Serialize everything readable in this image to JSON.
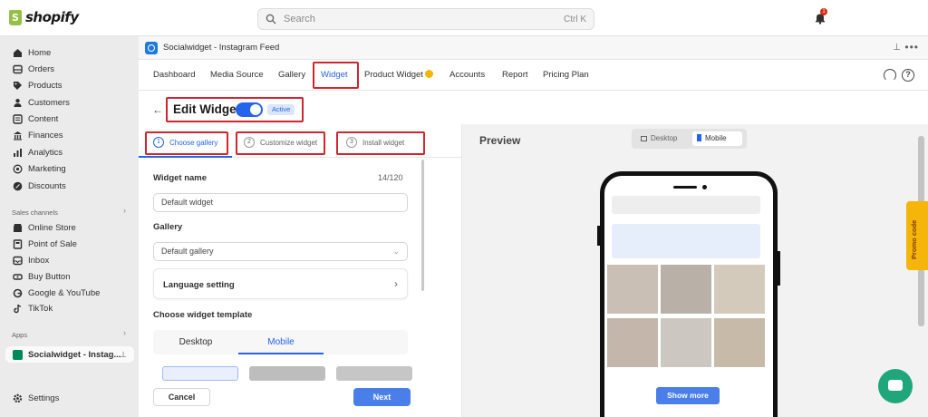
{
  "topbar": {
    "logo_text": "shopify",
    "search_placeholder": "Search",
    "search_shortcut": "Ctrl K",
    "notification_count": "1"
  },
  "sidebar": {
    "items": [
      {
        "label": "Home",
        "icon": "home-icon"
      },
      {
        "label": "Orders",
        "icon": "orders-icon"
      },
      {
        "label": "Products",
        "icon": "tag-icon"
      },
      {
        "label": "Customers",
        "icon": "person-icon"
      },
      {
        "label": "Content",
        "icon": "content-icon"
      },
      {
        "label": "Finances",
        "icon": "bank-icon"
      },
      {
        "label": "Analytics",
        "icon": "chart-icon"
      },
      {
        "label": "Marketing",
        "icon": "target-icon"
      },
      {
        "label": "Discounts",
        "icon": "discount-icon"
      }
    ],
    "sales_channels_label": "Sales channels",
    "channels": [
      {
        "label": "Online Store",
        "icon": "store-icon"
      },
      {
        "label": "Point of Sale",
        "icon": "pos-icon"
      },
      {
        "label": "Inbox",
        "icon": "inbox-icon"
      },
      {
        "label": "Buy Button",
        "icon": "buy-button-icon"
      },
      {
        "label": "Google & YouTube",
        "icon": "google-icon"
      },
      {
        "label": "TikTok",
        "icon": "tiktok-icon"
      }
    ],
    "apps_label": "Apps",
    "active_app": "Socialwidget - Instag...",
    "settings": "Settings"
  },
  "app": {
    "title": "Socialwidget - Instagram Feed",
    "tabs": [
      "Dashboard",
      "Media Source",
      "Gallery",
      "Widget",
      "Product Widget",
      "Accounts",
      "Report",
      "Pricing Plan"
    ],
    "active_tab": "Widget"
  },
  "editor": {
    "title": "Edit Widget",
    "status": "Active",
    "toggle_on": true,
    "steps": [
      {
        "num": "1",
        "label": "Choose gallery"
      },
      {
        "num": "2",
        "label": "Customize widget"
      },
      {
        "num": "3",
        "label": "Install widget"
      }
    ],
    "widget_name_label": "Widget name",
    "widget_name_counter": "14/120",
    "widget_name_value": "Default widget",
    "gallery_label": "Gallery",
    "gallery_value": "Default gallery",
    "language_setting": "Language setting",
    "template_label": "Choose widget template",
    "template_tabs": [
      "Desktop",
      "Mobile"
    ],
    "template_active": "Mobile",
    "cancel": "Cancel",
    "next": "Next"
  },
  "preview": {
    "title": "Preview",
    "devices": [
      "Desktop",
      "Mobile"
    ],
    "active_device": "Mobile",
    "show_more": "Show more"
  },
  "promo": {
    "label": "Promo code"
  },
  "colors": {
    "accent": "#2463eb",
    "highlight": "#d0262f",
    "promo": "#f5b50a",
    "chat": "#1fa67a"
  }
}
